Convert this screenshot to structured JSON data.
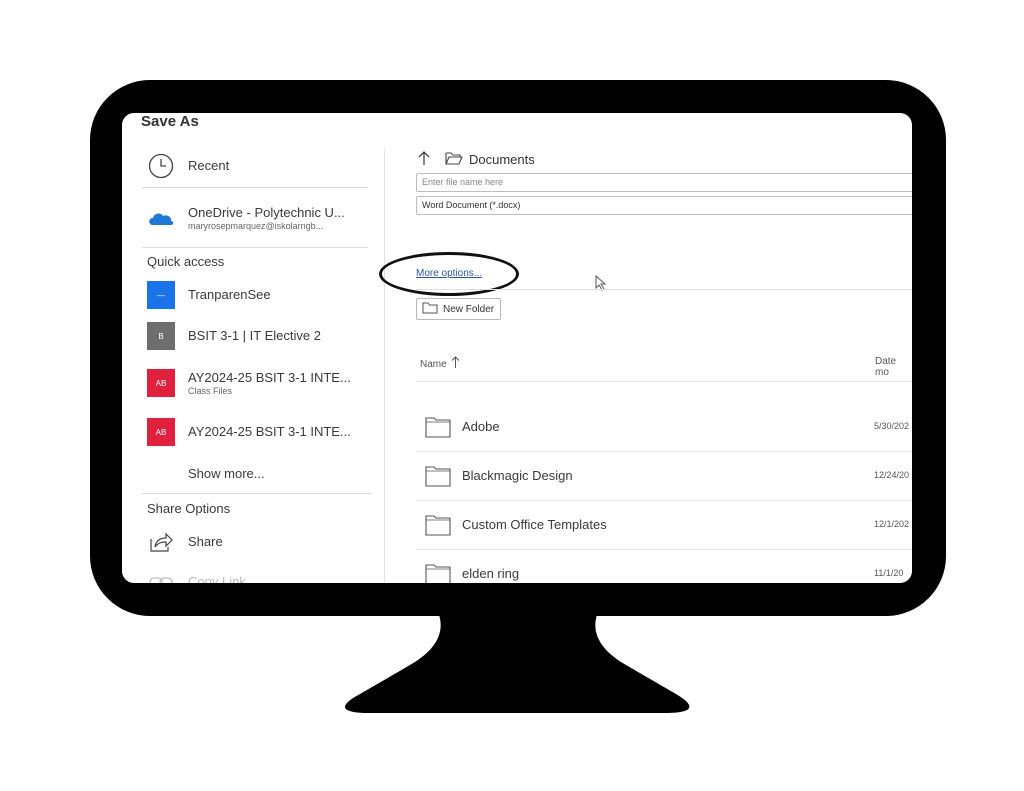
{
  "dialog": {
    "title": "Save As"
  },
  "sidebar": {
    "recent": {
      "label": "Recent",
      "icon": "clock-icon"
    },
    "onedrive": {
      "label": "OneDrive - Polytechnic U...",
      "sub": "maryrosepmarquez@iskolarngb...",
      "icon": "cloud-icon",
      "color": "#1e78d6"
    },
    "quick_access_heading": "Quick access",
    "quick_access": [
      {
        "label": "TranparenSee",
        "sub": "",
        "tile_text": "—",
        "color": "#1a73e8"
      },
      {
        "label": "BSIT 3-1 | IT Elective 2",
        "sub": "",
        "tile_text": "B",
        "color": "#6e6e6e"
      },
      {
        "label": "AY2024-25 BSIT 3-1 INTE...",
        "sub": "Class Files",
        "tile_text": "AB",
        "color": "#e0203c"
      },
      {
        "label": "AY2024-25 BSIT 3-1 INTE...",
        "sub": "",
        "tile_text": "AB",
        "color": "#e0203c"
      }
    ],
    "show_more": "Show more...",
    "share_heading": "Share Options",
    "share": {
      "label": "Share",
      "icon": "share-icon"
    },
    "copy_link": {
      "label": "Copy Link",
      "icon": "link-icon"
    }
  },
  "main": {
    "path": {
      "up_icon": "arrow-up-icon",
      "folder_icon": "folder-open-icon",
      "location": "Documents"
    },
    "filename_placeholder": "Enter file name here",
    "file_type": "Word Document (*.docx)",
    "more_options": "More options...",
    "new_folder": "New Folder",
    "columns": {
      "name": "Name",
      "sort_icon": "sort-up-arrow-icon",
      "date": "Date mo"
    },
    "rows": [
      {
        "name": "Adobe",
        "date": "5/30/202"
      },
      {
        "name": "Blackmagic Design",
        "date": "12/24/20"
      },
      {
        "name": "Custom Office Templates",
        "date": "12/1/202"
      },
      {
        "name": "elden ring",
        "date": "11/1/20"
      }
    ]
  }
}
